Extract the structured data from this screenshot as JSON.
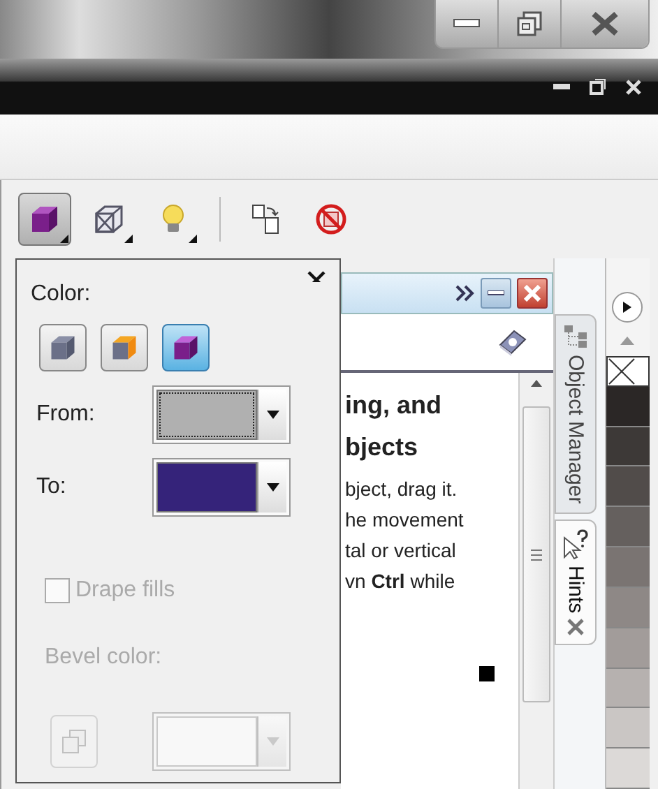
{
  "toolbar": {
    "items": [
      {
        "kind": "extrude",
        "selected": true,
        "menu": true
      },
      {
        "kind": "vanishing",
        "selected": false,
        "menu": true
      },
      {
        "kind": "lighting",
        "selected": false,
        "menu": true
      },
      {
        "kind": "copy",
        "selected": false,
        "menu": false
      },
      {
        "kind": "clear",
        "selected": false,
        "menu": false
      }
    ]
  },
  "popup": {
    "color_label": "Color:",
    "modes": [
      {
        "kind": "object",
        "selected": false
      },
      {
        "kind": "solid",
        "selected": false
      },
      {
        "kind": "shade",
        "selected": true
      }
    ],
    "from": {
      "label": "From:",
      "color": "#b0b0b0"
    },
    "to": {
      "label": "To:",
      "color": "#35237a"
    },
    "drape_fills": {
      "label": "Drape fills",
      "checked": false
    },
    "bevel": {
      "label": "Bevel color:",
      "disabled": true,
      "color": "#ffffff"
    }
  },
  "docker": {
    "heading": [
      "ing, and",
      "bjects"
    ],
    "body": [
      "bject, drag it.",
      "he movement",
      "tal or vertical",
      "vn **Ctrl** while"
    ]
  },
  "tabs": [
    {
      "label": "Object Manager",
      "kind": "objects",
      "selected": false
    },
    {
      "label": "Hints",
      "kind": "hints",
      "selected": true
    }
  ],
  "palette": {
    "swatches": [
      {
        "kind": "none"
      },
      {
        "kind": "color",
        "color": "#2b2726"
      },
      {
        "kind": "color",
        "color": "#3d3937"
      },
      {
        "kind": "color",
        "color": "#514c4a"
      },
      {
        "kind": "color",
        "color": "#65605e"
      },
      {
        "kind": "color",
        "color": "#7a7472"
      },
      {
        "kind": "color",
        "color": "#8e8886"
      },
      {
        "kind": "color",
        "color": "#a29c9a"
      },
      {
        "kind": "color",
        "color": "#b6b1af"
      },
      {
        "kind": "color",
        "color": "#cac6c4"
      },
      {
        "kind": "color",
        "color": "#dcd9d7"
      }
    ]
  }
}
